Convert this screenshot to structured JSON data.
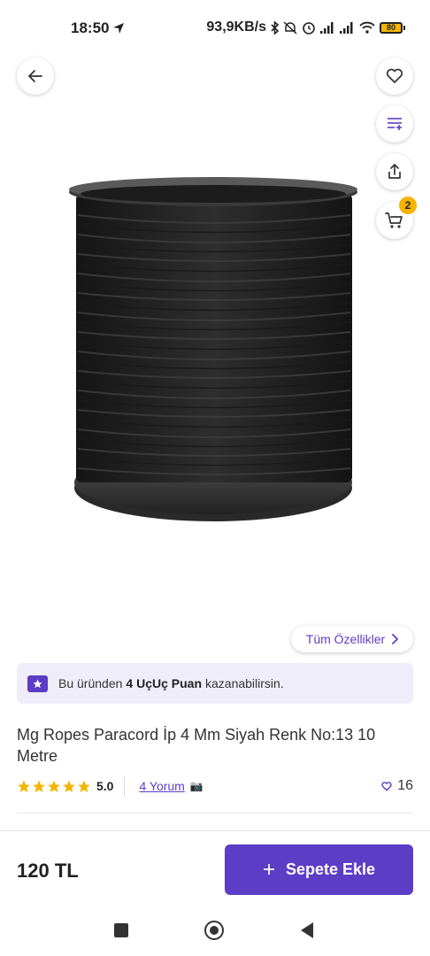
{
  "status_bar": {
    "time": "18:50",
    "network_speed": "93,9KB/s",
    "battery": "80",
    "icons": [
      "location-arrow-icon",
      "bluetooth-icon",
      "mute-icon",
      "alarm-icon",
      "signal-icon",
      "signal-icon",
      "wifi-icon",
      "battery-icon"
    ]
  },
  "header": {
    "back_icon": "arrow-left-icon",
    "favorite_icon": "heart-icon",
    "filter_icon": "list-filter-icon",
    "share_icon": "share-icon",
    "cart_icon": "cart-icon",
    "cart_badge": "2"
  },
  "product": {
    "specs_link": "Tüm Özellikler",
    "points_banner": {
      "prefix": "Bu üründen",
      "highlight": "4 UçUç Puan",
      "suffix": "kazanabilirsin."
    },
    "title": "Mg Ropes Paracord İp 4 Mm Siyah Renk No:13 10 Metre",
    "rating": {
      "stars": 5,
      "score": "5.0",
      "reviews": "4 Yorum",
      "likes": "16"
    }
  },
  "bottom_bar": {
    "price": "120 TL",
    "add_to_cart": "Sepete Ekle"
  },
  "colors": {
    "accent": "#5c3dc6",
    "star": "#f5b400",
    "banner_bg": "#efedfa"
  }
}
